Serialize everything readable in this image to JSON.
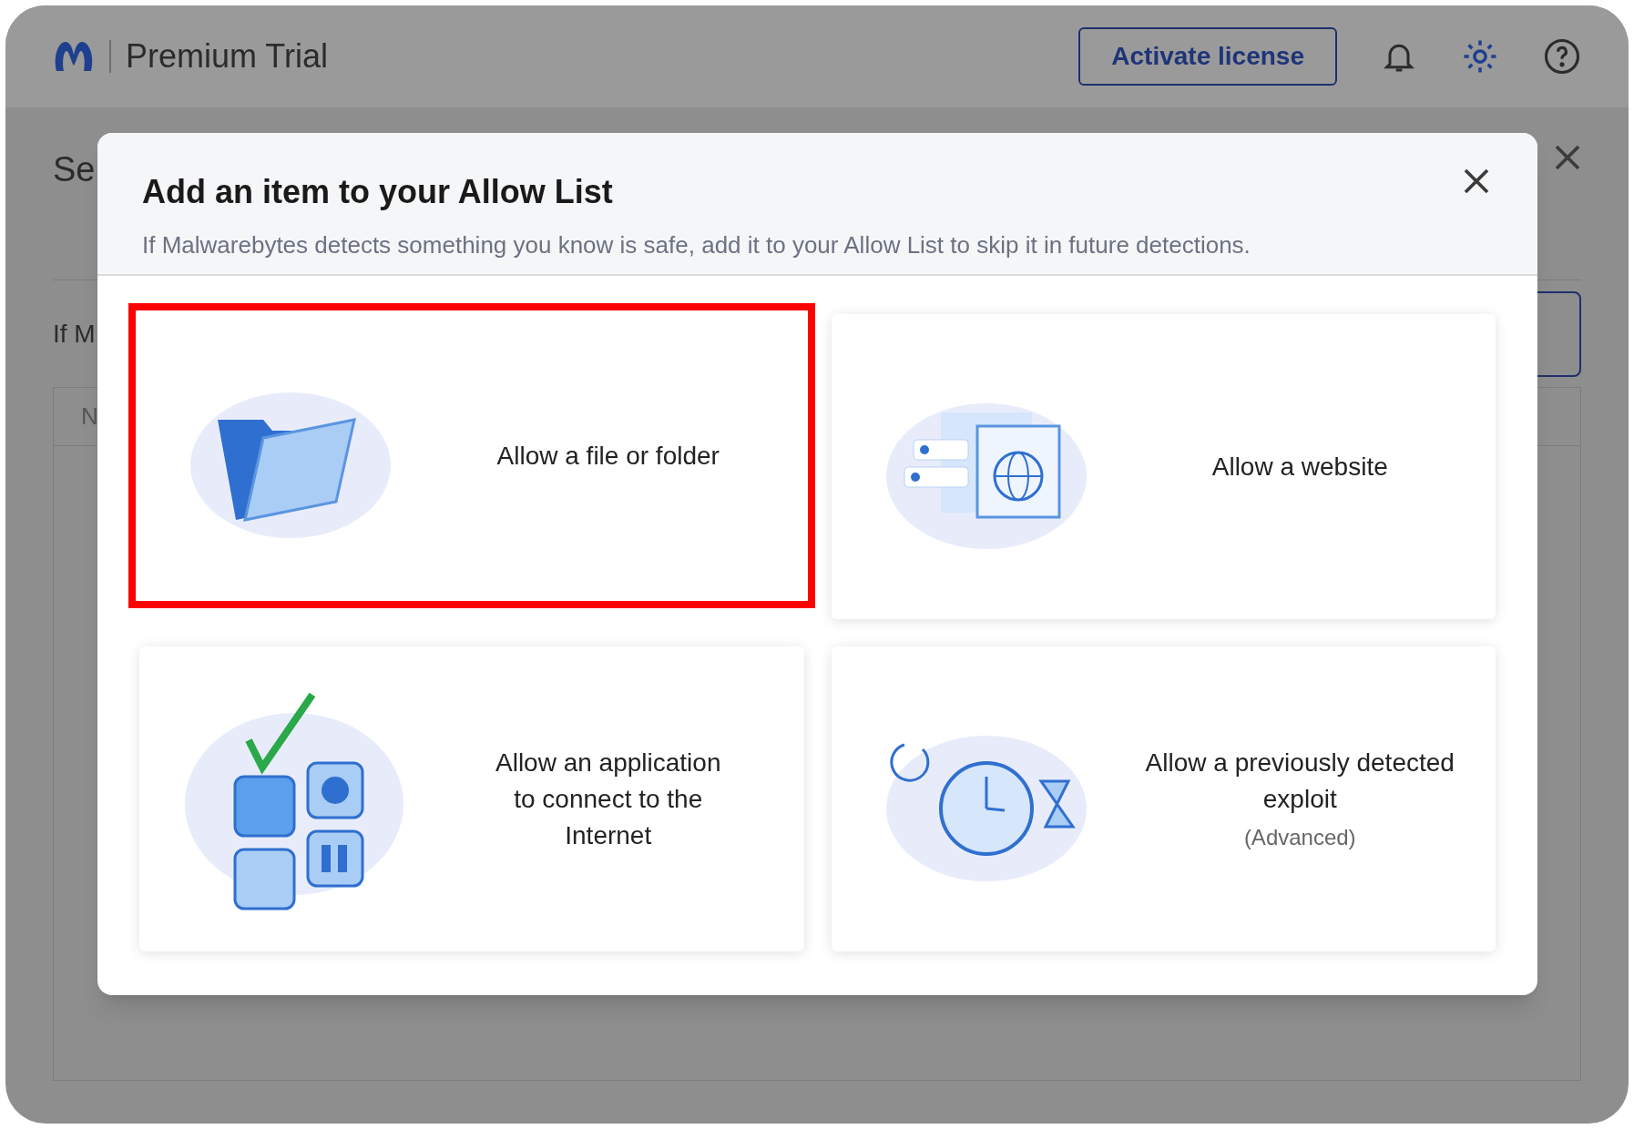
{
  "app_bar": {
    "brand": "Premium Trial",
    "activate_button": "Activate license"
  },
  "background": {
    "heading": "Se",
    "intro": "If M",
    "table_header": "N"
  },
  "dialog": {
    "title": "Add an item to your Allow List",
    "subtitle": "If Malwarebytes detects something you know is safe, add it to your Allow List to skip it in future detections.",
    "options": [
      {
        "kind": "file",
        "label": "Allow a file or folder",
        "selected": true
      },
      {
        "kind": "website",
        "label": "Allow a website",
        "selected": false
      },
      {
        "kind": "application",
        "label": "Allow an application to connect to the Internet",
        "selected": false
      },
      {
        "kind": "exploit",
        "label": "Allow a previously detected exploit",
        "note": "(Advanced)",
        "selected": false
      }
    ]
  }
}
